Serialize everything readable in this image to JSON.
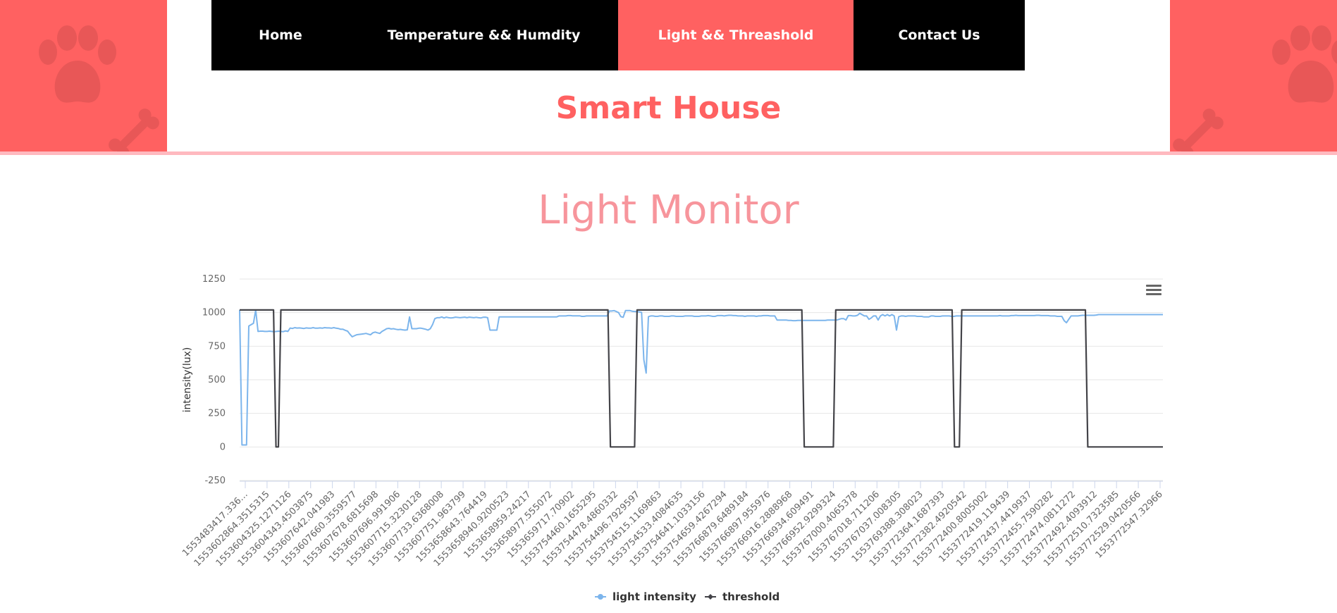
{
  "nav": {
    "items": [
      {
        "label": "Home"
      },
      {
        "label": "Temperature && Humdity"
      },
      {
        "label": "Light && Threashold",
        "active": true
      },
      {
        "label": "Contact Us"
      }
    ]
  },
  "site_title": "Smart House",
  "page_heading": "Light Monitor",
  "colors": {
    "accent": "#ff6161",
    "heading": "#f7959c",
    "navbar": "#000000",
    "light_series": "#7cb5ec",
    "threshold_series": "#434348"
  },
  "icons": {
    "decor": [
      "paw-icon",
      "bone-icon"
    ],
    "chart_menu": "hamburger-menu-icon"
  },
  "chart_data": {
    "type": "line",
    "ylabel": "intensity(lux)",
    "ylim": [
      -250,
      1250
    ],
    "yticks": [
      1250,
      1000,
      750,
      500,
      250,
      0,
      -250
    ],
    "grid": true,
    "legend": "bottom-center",
    "xtick_labels": [
      "1553483417.336…",
      "1553602864.3515315",
      "1553604325.1271126",
      "1553604343.4503875",
      "1553607642.041983",
      "1553607660.3559577",
      "1553607678.6815698",
      "1553607696.991906",
      "1553607715.3230128",
      "1553607733.6368008",
      "1553607751.963799",
      "1553658643.764419",
      "1553658940.9200523",
      "1553658959.24217",
      "1553658977.555072",
      "1553659717.70902",
      "1553754460.1655295",
      "1553754478.4860332",
      "1553754496.7929597",
      "1553754515.1169863",
      "1553754533.4084635",
      "1553754641.1033156",
      "1553754659.4267294",
      "1553766879.6489184",
      "1553766897.955976",
      "1553766916.2888968",
      "1553766934.609491",
      "1553766952.9299324",
      "1553767000.4065378",
      "1553767018.711206",
      "1553767037.008305",
      "1553769388.308023",
      "1553772364.1687393",
      "1553772382.4920542",
      "1553772400.8005002",
      "1553772419.119439",
      "1553772437.4419937",
      "1553772455.7590282",
      "1553772474.0811272",
      "1553772492.4093912",
      "1553772510.7323585",
      "1553772529.0420566",
      "1553772547.32966"
    ],
    "series": [
      {
        "name": "light intensity",
        "values": [
          1020,
          15,
          15,
          15,
          900,
          910,
          920,
          1020,
          860,
          862,
          862,
          860,
          860,
          862,
          860,
          858,
          860,
          862,
          860,
          858,
          864,
          860,
          885,
          882,
          888,
          885,
          886,
          884,
          882,
          886,
          884,
          884,
          888,
          884,
          884,
          886,
          884,
          888,
          886,
          886,
          884,
          888,
          884,
          882,
          876,
          876,
          868,
          862,
          840,
          820,
          828,
          835,
          838,
          840,
          842,
          845,
          840,
          835,
          850,
          855,
          850,
          845,
          860,
          870,
          880,
          883,
          878,
          880,
          876,
          873,
          875,
          872,
          870,
          872,
          968,
          880,
          880,
          880,
          884,
          884,
          880,
          876,
          870,
          880,
          910,
          955,
          962,
          962,
          968,
          960,
          966,
          962,
          960,
          962,
          966,
          964,
          962,
          964,
          966,
          962,
          966,
          964,
          962,
          965,
          962,
          960,
          965,
          966,
          962,
          870,
          870,
          870,
          870,
          968,
          968,
          968,
          968,
          968,
          968,
          968,
          968,
          968,
          968,
          968,
          968,
          968,
          968,
          968,
          968,
          968,
          968,
          968,
          968,
          968,
          968,
          968,
          968,
          968,
          968,
          975,
          975,
          975,
          975,
          978,
          978,
          976,
          976,
          976,
          976,
          972,
          972,
          975,
          975,
          975,
          975,
          975,
          975,
          975,
          975,
          975,
          975,
          1012,
          1012,
          1015,
          1008,
          1000,
          970,
          965,
          1015,
          1015,
          1015,
          1010,
          1008,
          1008,
          1005,
          1002,
          650,
          550,
          970,
          975,
          975,
          972,
          972,
          975,
          975,
          972,
          972,
          972,
          975,
          975,
          972,
          972,
          972,
          972,
          975,
          975,
          975,
          975,
          972,
          972,
          972,
          975,
          975,
          975,
          978,
          975,
          972,
          972,
          978,
          978,
          978,
          975,
          978,
          980,
          980,
          978,
          978,
          975,
          975,
          975,
          972,
          975,
          975,
          975,
          975,
          972,
          975,
          975,
          978,
          978,
          978,
          975,
          975,
          975,
          945,
          945,
          945,
          945,
          945,
          942,
          942,
          940,
          940,
          942,
          942,
          942,
          942,
          942,
          942,
          942,
          942,
          942,
          942,
          942,
          942,
          942,
          945,
          945,
          945,
          945,
          945,
          950,
          955,
          955,
          945,
          978,
          978,
          975,
          975,
          980,
          995,
          985,
          975,
          975,
          950,
          960,
          975,
          975,
          945,
          975,
          985,
          975,
          985,
          975,
          985,
          975,
          870,
          970,
          975,
          975,
          972,
          975,
          975,
          975,
          975,
          972,
          972,
          972,
          968,
          968,
          968,
          975,
          975,
          972,
          972,
          972,
          975,
          975,
          975,
          975,
          972,
          972,
          975,
          975,
          975,
          975,
          975,
          975,
          975,
          975,
          975,
          975,
          975,
          975,
          975,
          975,
          975,
          975,
          975,
          975,
          975,
          978,
          975,
          975,
          975,
          975,
          978,
          978,
          980,
          978,
          978,
          978,
          978,
          978,
          978,
          978,
          978,
          980,
          980,
          978,
          978,
          978,
          978,
          975,
          975,
          975,
          972,
          972,
          972,
          940,
          925,
          950,
          975,
          975,
          975,
          975,
          978,
          980,
          980,
          980,
          980,
          980,
          980,
          982,
          985,
          985,
          985,
          985,
          985,
          985,
          985,
          985,
          985,
          985,
          985,
          985,
          985,
          985,
          985,
          985,
          985,
          985,
          985,
          985,
          985,
          985,
          985,
          985,
          985,
          985,
          985,
          985,
          985
        ]
      },
      {
        "name": "threshold",
        "values": [
          1020,
          1020,
          1020,
          1020,
          1020,
          1020,
          1020,
          1020,
          1020,
          1020,
          1020,
          1020,
          1020,
          1020,
          1020,
          0,
          0,
          1020,
          1020,
          1020,
          1020,
          1020,
          1020,
          1020,
          1020,
          1020,
          1020,
          1020,
          1020,
          1020,
          1020,
          1020,
          1020,
          1020,
          1020,
          1020,
          1020,
          1020,
          1020,
          1020,
          1020,
          1020,
          1020,
          1020,
          1020,
          1020,
          1020,
          1020,
          1020,
          1020,
          1020,
          1020,
          1020,
          1020,
          1020,
          1020,
          1020,
          1020,
          1020,
          1020,
          1020,
          1020,
          1020,
          1020,
          1020,
          1020,
          1020,
          1020,
          1020,
          1020,
          1020,
          1020,
          1020,
          1020,
          1020,
          1020,
          1020,
          1020,
          1020,
          1020,
          1020,
          1020,
          1020,
          1020,
          1020,
          1020,
          1020,
          1020,
          1020,
          1020,
          1020,
          1020,
          1020,
          1020,
          1020,
          1020,
          1020,
          1020,
          1020,
          1020,
          1020,
          1020,
          1020,
          1020,
          1020,
          1020,
          1020,
          1020,
          1020,
          1020,
          1020,
          1020,
          1020,
          1020,
          1020,
          1020,
          1020,
          1020,
          1020,
          1020,
          1020,
          1020,
          1020,
          1020,
          1020,
          1020,
          1020,
          1020,
          1020,
          1020,
          1020,
          1020,
          1020,
          1020,
          1020,
          1020,
          1020,
          1020,
          1020,
          1020,
          1020,
          1020,
          1020,
          1020,
          1020,
          1020,
          1020,
          1020,
          1020,
          1020,
          1020,
          1020,
          1020,
          0,
          0,
          0,
          0,
          0,
          0,
          0,
          0,
          0,
          0,
          0,
          1020,
          1020,
          1020,
          1020,
          1020,
          1020,
          1020,
          1020,
          1020,
          1020,
          1020,
          1020,
          1020,
          1020,
          1020,
          1020,
          1020,
          1020,
          1020,
          1020,
          1020,
          1020,
          1020,
          1020,
          1020,
          1020,
          1020,
          1020,
          1020,
          1020,
          1020,
          1020,
          1020,
          1020,
          1020,
          1020,
          1020,
          1020,
          1020,
          1020,
          1020,
          1020,
          1020,
          1020,
          1020,
          1020,
          1020,
          1020,
          1020,
          1020,
          1020,
          1020,
          1020,
          1020,
          1020,
          1020,
          1020,
          1020,
          1020,
          1020,
          1020,
          1020,
          1020,
          1020,
          1020,
          1020,
          1020,
          1020,
          1020,
          0,
          0,
          0,
          0,
          0,
          0,
          0,
          0,
          0,
          0,
          0,
          0,
          0,
          1020,
          1020,
          1020,
          1020,
          1020,
          1020,
          1020,
          1020,
          1020,
          1020,
          1020,
          1020,
          1020,
          1020,
          1020,
          1020,
          1020,
          1020,
          1020,
          1020,
          1020,
          1020,
          1020,
          1020,
          1020,
          1020,
          1020,
          1020,
          1020,
          1020,
          1020,
          1020,
          1020,
          1020,
          1020,
          1020,
          1020,
          1020,
          1020,
          1020,
          1020,
          1020,
          1020,
          1020,
          1020,
          1020,
          1020,
          1020,
          1020,
          0,
          0,
          0,
          1020,
          1020,
          1020,
          1020,
          1020,
          1020,
          1020,
          1020,
          1020,
          1020,
          1020,
          1020,
          1020,
          1020,
          1020,
          1020,
          1020,
          1020,
          1020,
          1020,
          1020,
          1020,
          1020,
          1020,
          1020,
          1020,
          1020,
          1020,
          1020,
          1020,
          1020,
          1020,
          1020,
          1020,
          1020,
          1020,
          1020,
          1020,
          1020,
          1020,
          1020,
          1020,
          1020,
          1020,
          1020,
          1020,
          1020,
          1020,
          1020,
          1020,
          1020,
          1020,
          0,
          0,
          0,
          0,
          0,
          0,
          0,
          0,
          0,
          0,
          0,
          0,
          0,
          0,
          0,
          0,
          0,
          0,
          0,
          0,
          0,
          0,
          0,
          0,
          0,
          0,
          0,
          0,
          0,
          0,
          0,
          0
        ]
      }
    ]
  }
}
